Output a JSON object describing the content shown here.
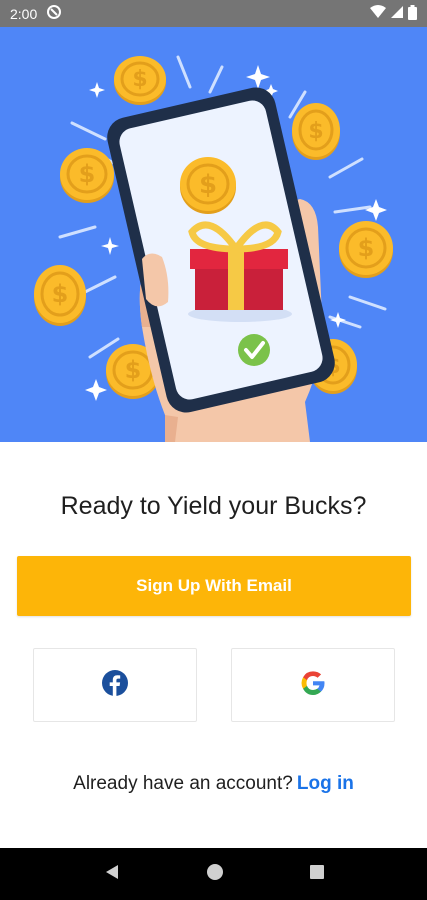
{
  "status_bar": {
    "time": "2:00",
    "icons": [
      "sync-icon",
      "wifi-icon",
      "cellular-signal-icon",
      "battery-icon"
    ]
  },
  "hero": {
    "illustration": "hand-holding-phone-with-gift-and-coins",
    "background_color": "#4f86f7"
  },
  "main": {
    "headline": "Ready to Yield your Bucks?",
    "email_button_label": "Sign Up With Email",
    "email_button_color": "#fdb508",
    "facebook_icon": "facebook-icon",
    "google_icon": "google-icon",
    "login_prompt": "Already have an account?",
    "login_link": "Log in",
    "link_color": "#1a73e8"
  },
  "nav_bar": {
    "icons": [
      "back-icon",
      "home-icon",
      "recents-icon"
    ]
  }
}
